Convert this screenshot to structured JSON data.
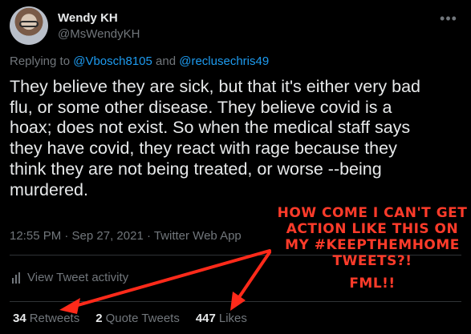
{
  "author": {
    "display_name": "Wendy KH",
    "handle": "@MsWendyKH"
  },
  "more_label": "•••",
  "reply": {
    "prefix": "Replying to ",
    "mention1": "@Vbosch8105",
    "joiner": " and ",
    "mention2": "@reclusechris49"
  },
  "tweet": {
    "text": "They believe they are sick, but that it's either very bad\nflu, or some other disease. They believe covid is a\nhoax; does not exist. So when the medical staff says\nthey have covid, they react with rage because they\nthink they are not being treated, or worse --being\nmurdered.",
    "meta": "12:55 PM · Sep 27, 2021 · Twitter Web App"
  },
  "activity_label": "View Tweet activity",
  "stats": {
    "retweets_num": "34",
    "retweets_label": "Retweets",
    "quotes_num": "2",
    "quotes_label": "Quote Tweets",
    "likes_num": "447",
    "likes_label": "Likes"
  },
  "annotation": {
    "lines": [
      "HOW COME I CAN'T GET",
      "ACTION LIKE THIS ON",
      "MY #KEEPTHEMHOME",
      "TWEETS?!"
    ],
    "fml": "FML!!",
    "color": "#ff3b2a"
  },
  "colors": {
    "background": "#000000",
    "text": "#e7e9ea",
    "muted": "#71767b",
    "link": "#1d9bf0",
    "divider": "#2f3336"
  }
}
